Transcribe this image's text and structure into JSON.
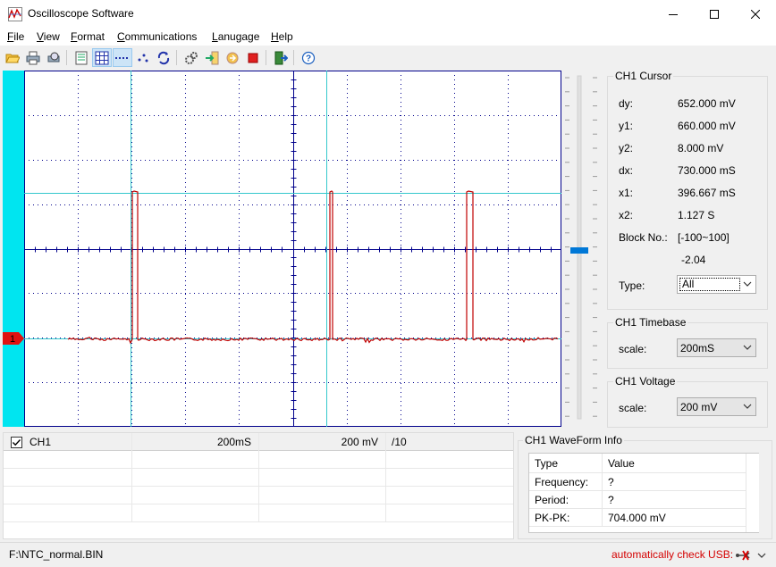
{
  "window": {
    "title": "Oscilloscope Software"
  },
  "menu": [
    {
      "label": "File",
      "ul": "F",
      "rest": "ile"
    },
    {
      "label": "View",
      "ul": "V",
      "rest": "iew"
    },
    {
      "label": "Format",
      "ul": "F",
      "rest": "ormat"
    },
    {
      "label": "Communications",
      "ul": "C",
      "rest": "ommunications"
    },
    {
      "label": "Lanugage",
      "ul": "L",
      "rest": "anugage"
    },
    {
      "label": "Help",
      "ul": "H",
      "rest": "elp"
    }
  ],
  "scope": {
    "channel_marker": "1"
  },
  "cursor_panel": {
    "title": "CH1 Cursor",
    "dy_label": "dy:",
    "dy_value": "652.000 mV",
    "y1_label": "y1:",
    "y1_value": "660.000 mV",
    "y2_label": "y2:",
    "y2_value": "8.000 mV",
    "dx_label": "dx:",
    "dx_value": "730.000 mS",
    "x1_label": "x1:",
    "x1_value": "396.667 mS",
    "x2_label": "x2:",
    "x2_value": "1.127 S",
    "block_label": "Block No.:",
    "block_value": "[-100~100]",
    "block_num": "-2.04",
    "type_label": "Type:",
    "type_value": "All"
  },
  "timebase_panel": {
    "title": "CH1 Timebase",
    "scale_label": "scale:",
    "scale_value": "200mS"
  },
  "voltage_panel": {
    "title": "CH1 Voltage",
    "scale_label": "scale:",
    "scale_value": "200 mV"
  },
  "channel_table": {
    "row": {
      "name": "CH1",
      "timebase": "200mS",
      "voltage": "200 mV",
      "probe": "/10"
    }
  },
  "waveform_info": {
    "title": "CH1 WaveForm Info",
    "header": [
      "Type",
      "Value"
    ],
    "rows": [
      [
        "Frequency:",
        "?"
      ],
      [
        "Period:",
        "?"
      ],
      [
        "PK-PK:",
        "704.000 mV"
      ]
    ]
  },
  "status": {
    "file_path": "F:\\NTC_normal.BIN",
    "usb_text": "automatically check USB:"
  },
  "colors": {
    "accent": "#0078d7",
    "scope_left_bar": "#00e5f0",
    "trace": "#c00000",
    "grid": "#00008b",
    "cursor": "#34c8cc",
    "status_text": "#d40000"
  }
}
